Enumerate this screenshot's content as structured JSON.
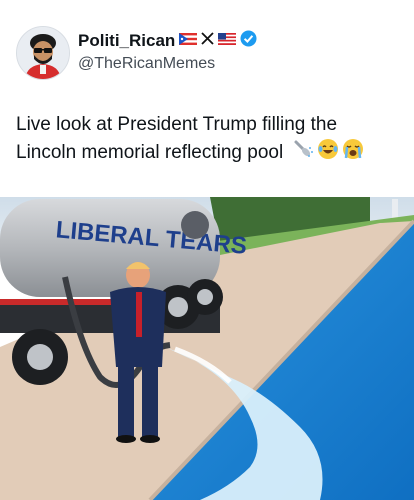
{
  "post": {
    "author": {
      "display_name": "Politi_Rican",
      "handle": "@TheRicanMemes",
      "verified": true,
      "badges": [
        "puerto-rico-flag-icon",
        "x-logo-icon",
        "us-flag-icon",
        "verified-badge-icon"
      ]
    },
    "text": "Live look at President Trump filling the Lincoln memorial reflecting pool",
    "emojis": [
      "shower-icon",
      "laughing-tears-emoji",
      "crying-emoji"
    ],
    "image": {
      "truck_text": "LIBERAL TEARS",
      "colors": {
        "sky": "#dfe8f0",
        "pool": "#1f88d8",
        "pavement": "#e2ccb8",
        "grass": "#7bb35a",
        "tank": "#b9bcc0",
        "cab": "#2b2e33"
      }
    }
  }
}
